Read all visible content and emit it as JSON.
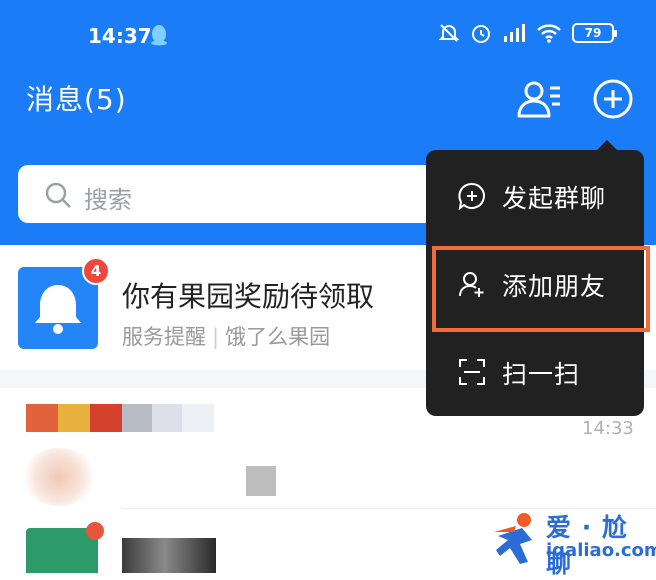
{
  "status_bar": {
    "time": "14:37",
    "battery": "79",
    "icons": [
      "qq-icon",
      "mute-icon",
      "alarm-icon",
      "signal-icon",
      "wifi-icon",
      "battery-icon"
    ]
  },
  "header": {
    "title": "消息(5)",
    "icons": [
      "contacts-icon",
      "plus-circle-icon"
    ]
  },
  "search": {
    "placeholder": "搜索"
  },
  "conversations": [
    {
      "title": "你有果园奖励待领取",
      "badge": "4",
      "subtitle_left": "服务提醒",
      "subtitle_sep": "|",
      "subtitle_right": "饿了么果园",
      "icon": "bell-icon"
    },
    {
      "time": "14:33"
    }
  ],
  "popup_menu": {
    "items": [
      {
        "label": "发起群聊",
        "icon": "group-chat-icon"
      },
      {
        "label": "添加朋友",
        "icon": "add-friend-icon",
        "highlighted": true
      },
      {
        "label": "扫一扫",
        "icon": "scan-icon"
      }
    ]
  },
  "watermark": {
    "title": "爱 · 尬聊",
    "url": "igaliao.com"
  },
  "colors": {
    "header_blue": "#1a7cf6",
    "menu_bg": "#212121",
    "highlight": "#f26b3a",
    "badge_red": "#f0463c"
  }
}
